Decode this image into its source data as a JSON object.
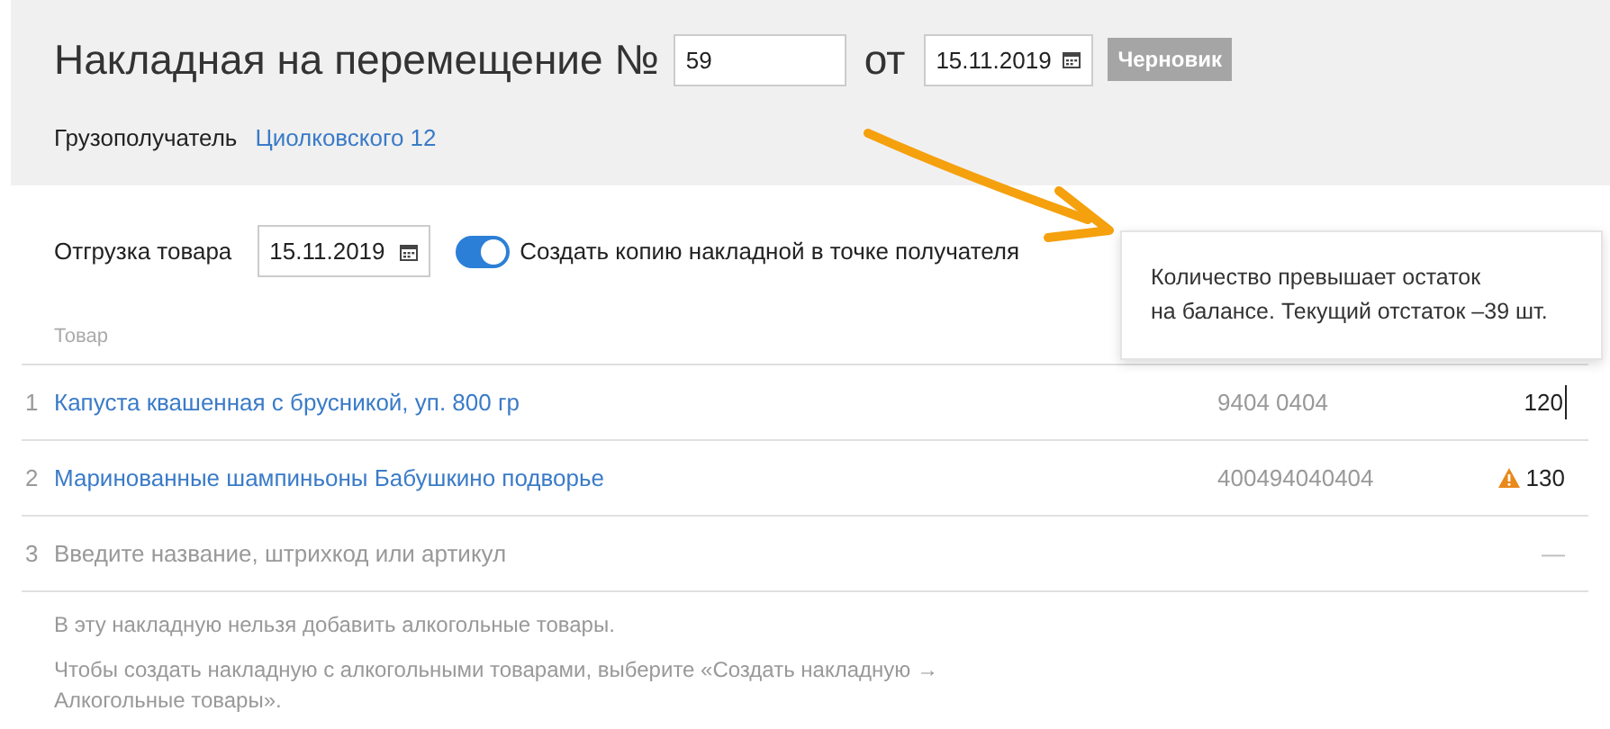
{
  "header": {
    "title": "Накладная на перемещение №",
    "number": "59",
    "date_prefix": "от",
    "date": "15.11.2019",
    "status": "Черновик",
    "recipient_label": "Грузополучатель",
    "recipient": "Циолковского 12"
  },
  "shipment": {
    "label": "Отгрузка товара",
    "date": "15.11.2019",
    "copy_toggle": {
      "on": true,
      "label": "Создать копию накладной в точке получателя"
    }
  },
  "tooltip": {
    "text": "Количество превышает остаток\nна балансе. Текущий отстаток –39 шт."
  },
  "table": {
    "columns": [
      "Товар"
    ],
    "rows": [
      {
        "kind": "item",
        "index": "1",
        "name": "Капуста квашенная с брусникой, уп. 800 гр",
        "barcode": "9404 0404",
        "quantity": "120",
        "editing": true,
        "warning": false
      },
      {
        "kind": "item",
        "index": "2",
        "name": "Маринованные шампиньоны Бабушкино подворье",
        "barcode": "400494040404",
        "quantity": "130",
        "editing": false,
        "warning": true
      },
      {
        "kind": "input",
        "index": "3",
        "placeholder": "Введите название, штрихкод или артикул",
        "quantity": "—"
      }
    ]
  },
  "notes": [
    "В эту накладную нельзя добавить алкогольные товары.",
    "Чтобы создать накладную с алкогольными товарами, выберите «Создать накладную →\nАлкогольные товары»."
  ]
}
